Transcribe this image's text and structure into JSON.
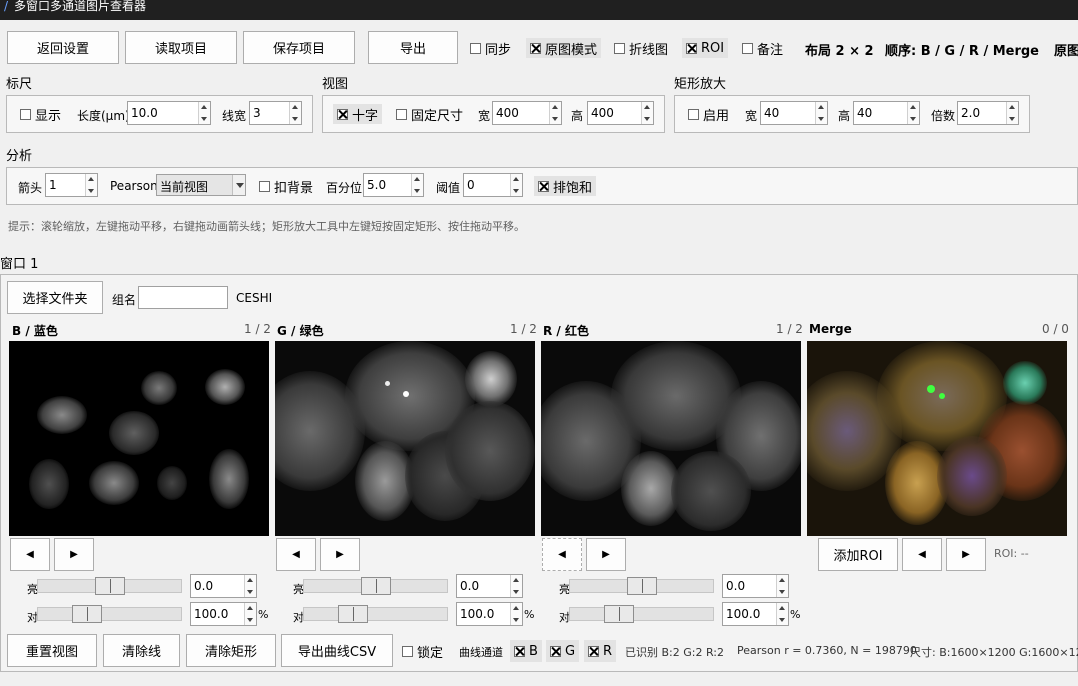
{
  "window": {
    "title": "多窗口多通道图片查看器"
  },
  "toolbar": {
    "back_settings": "返回设置",
    "read_project": "读取项目",
    "save_project": "保存项目",
    "export": "导出",
    "sync": "同步",
    "original_mode": "原图模式",
    "line_plot": "折线图",
    "roi": "ROI",
    "note": "备注",
    "layout": "布局 2 × 2",
    "order": "顺序: B / G / R / Merge",
    "original_trunc": "原图"
  },
  "scale": {
    "group_title": "标尺",
    "show": "显示",
    "length_label": "长度(μm)",
    "length_value": "10.0",
    "linewidth_label": "线宽",
    "linewidth_value": "3"
  },
  "view": {
    "group_title": "视图",
    "cross": "十字",
    "fixed_size": "固定尺寸",
    "width_label": "宽",
    "width_value": "400",
    "height_label": "高",
    "height_value": "400"
  },
  "rect_zoom": {
    "group_title": "矩形放大",
    "enable": "启用",
    "width_label": "宽",
    "width_value": "40",
    "height_label": "高",
    "height_value": "40",
    "factor_label": "倍数",
    "factor_value": "2.0"
  },
  "analysis": {
    "group_title": "分析",
    "arrow_label": "箭头",
    "arrow_value": "1",
    "pearson_label": "Pearson",
    "pearson_option": "当前视图",
    "subtract_bg": "扣背景",
    "percentile_label": "百分位",
    "percentile_value": "5.0",
    "threshold_label": "阈值",
    "threshold_value": "0",
    "exclude_sat": "排饱和"
  },
  "hint": "提示：滚轮缩放，左键拖动平移，右键拖动画箭头线；矩形放大工具中左键短按固定矩形、按住拖动平移。",
  "window1": {
    "title": "窗口 1",
    "select_folder": "选择文件夹",
    "group_label": "组名",
    "group_value": "",
    "folder_name": "CESHI"
  },
  "panels": [
    {
      "title": "B / 蓝色",
      "counter": "1 / 2"
    },
    {
      "title": "G / 绿色",
      "counter": "1 / 2"
    },
    {
      "title": "R / 红色",
      "counter": "1 / 2"
    },
    {
      "title": "Merge",
      "counter": "0 / 0"
    }
  ],
  "controls": {
    "prev": "◀",
    "next": "▶",
    "brightness_label": "亮",
    "contrast_label": "对",
    "brightness_value": "0.0",
    "contrast_value": "100.0",
    "percent": "%",
    "brightness_level": 0.5,
    "contrast_level": 0.3,
    "add_roi": "添加ROI",
    "roi_status": "ROI: --"
  },
  "bottom": {
    "reset_view": "重置视图",
    "clear_lines": "清除线",
    "clear_rects": "清除矩形",
    "export_csv": "导出曲线CSV",
    "lock": "锁定",
    "curve_channels": "曲线通道",
    "ch_b": "B",
    "ch_g": "G",
    "ch_r": "R",
    "identified": "已识别  B:2  G:2  R:2",
    "pearson_result": "Pearson r = 0.7360, N = 198790",
    "size": "尺寸:  B:1600×1200  G:1600×12"
  },
  "colors": {
    "titlebar": "#202020",
    "background": "#f0f0f0",
    "image_bg": "#000000"
  }
}
